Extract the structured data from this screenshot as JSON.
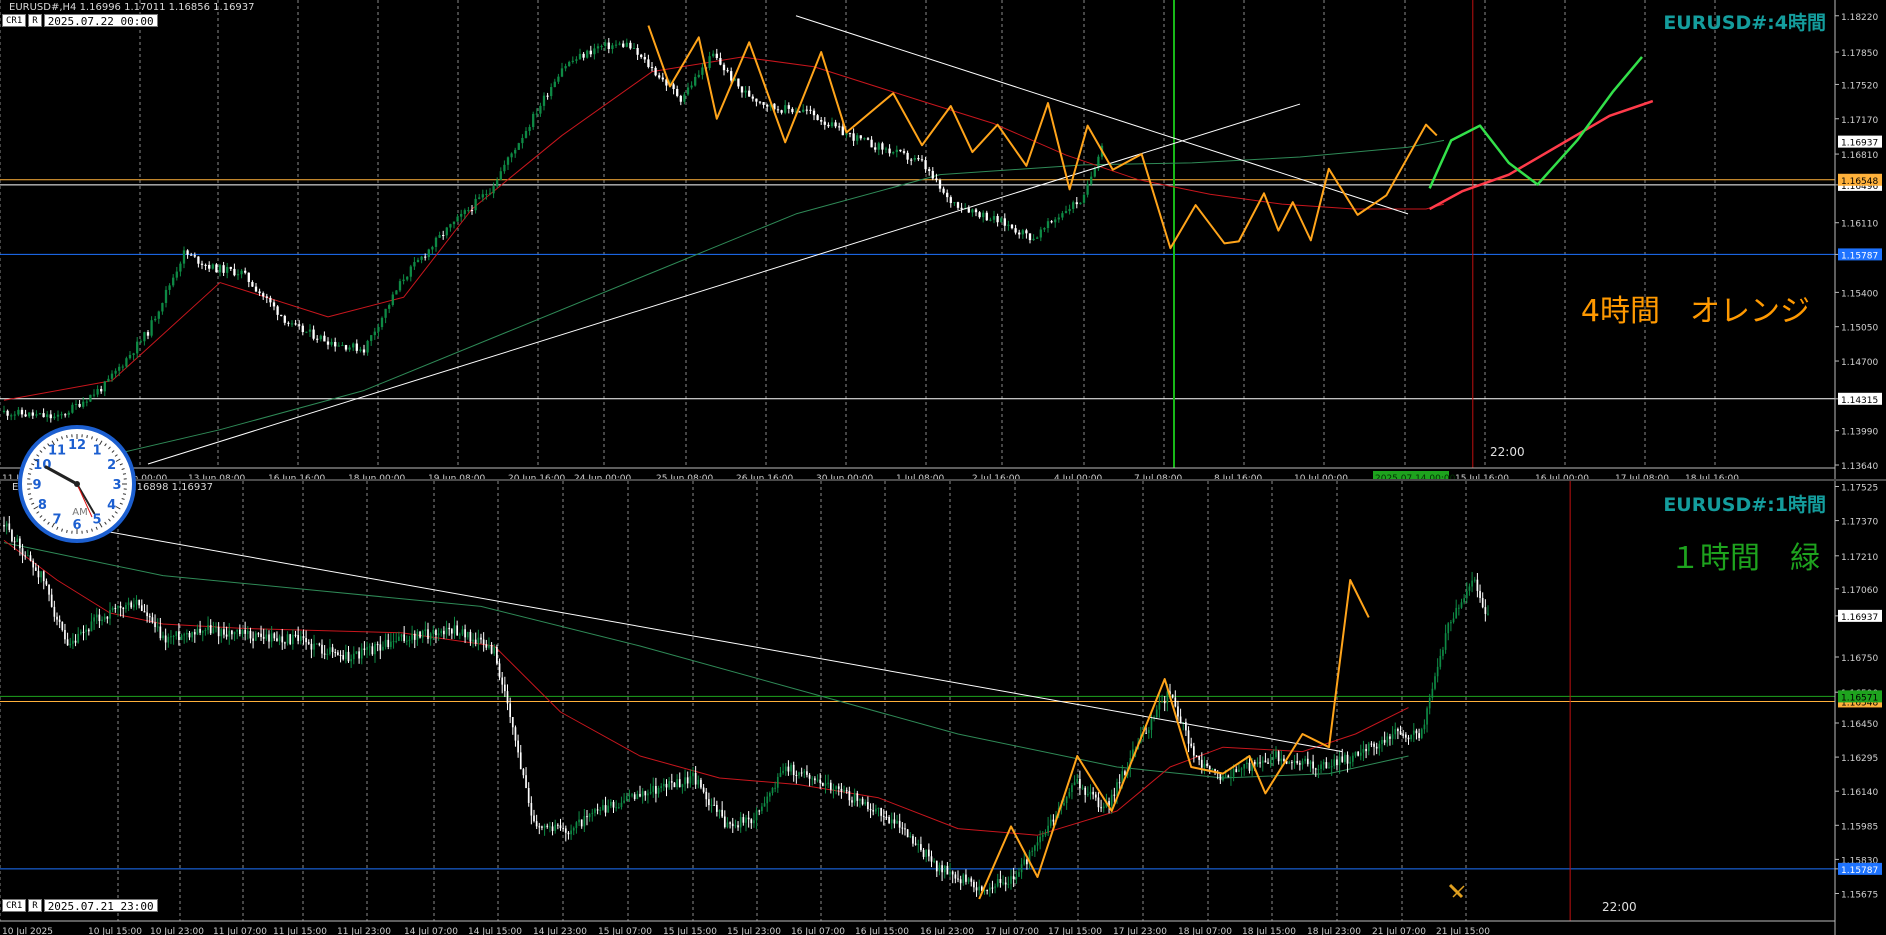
{
  "colors": {
    "background": "#000000",
    "bull_candle": "#0e8a45",
    "bear_candle": "#ffffff",
    "zigzag": "#ffa41a",
    "ma_red": "#c8161d",
    "ma_green": "#2f8a57",
    "trend_line": "#ffffff",
    "level_orange": "#ffb13b",
    "level_blue": "#1e73ff",
    "proj_green": "#33e04a",
    "proj_red": "#ff3b4a",
    "title_teal": "#149d9d",
    "note_orange": "#ff9900",
    "note_green": "#1ea31e",
    "vline_green": "#18b818",
    "vline_red": "#c01010"
  },
  "top": {
    "info": "EURUSD#,H4  1.16996 1.17011 1.16856 1.16937",
    "crosshair_chip": "2025.07.22 00:00",
    "chip_a": "CR1",
    "chip_b": "R",
    "title": "EURUSD#:4時間",
    "note": "4時間　オレンジ",
    "time_label": "22:00",
    "highlight_time": "2025.07.14 00:00"
  },
  "bottom": {
    "info": "EURUSD#,H1  1.16956 1.16898 1.16937",
    "crosshair_chip": "2025.07.21 23:00",
    "chip_a": "CR1",
    "chip_b": "R",
    "title": "EURUSD#:1時間",
    "note": "１時間　緑",
    "time_label": "22:00"
  },
  "clock": {
    "label": "AM",
    "numerals": [
      "12",
      "1",
      "2",
      "3",
      "4",
      "5",
      "6",
      "7",
      "8",
      "9",
      "10",
      "11"
    ]
  },
  "chart_data": [
    {
      "type": "candlestick",
      "title": "EURUSD#:4時間",
      "timeframe": "H4",
      "ylim": [
        1.1364,
        1.1834
      ],
      "y_ticks": [
        "1.18220",
        "1.17850",
        "1.17520",
        "1.17170",
        "1.16810",
        "1.16496",
        "1.16110",
        "1.15787",
        "1.15400",
        "1.15050",
        "1.14700",
        "1.14315",
        "1.13990",
        "1.13640"
      ],
      "x_ticks": [
        "11 Jun 2025",
        "12 Jun 00:00",
        "13 Jun 08:00",
        "16 Jun 16:00",
        "18 Jun 00:00",
        "19 Jun 08:00",
        "20 Jun 16:00",
        "24 Jun 00:00",
        "25 Jun 08:00",
        "26 Jun 16:00",
        "30 Jun 00:00",
        "1 Jul 08:00",
        "2 Jul 16:00",
        "4 Jul 00:00",
        "7 Jul 08:00",
        "8 Jul 16:00",
        "10 Jul 00:00",
        "2025.07.14 00:00",
        "15 Jul 16:00",
        "16 Jul 00:00",
        "17 Jul 08:00",
        "18 Jul 16:00"
      ],
      "y_labels_highlight": [
        {
          "value": "1.16937",
          "bg": "#ffffff",
          "fg": "#000000"
        },
        {
          "value": "1.16496",
          "bg": "#ffffff",
          "fg": "#000000"
        },
        {
          "value": "1.16548",
          "bg": "#ffb13b",
          "fg": "#000000"
        },
        {
          "value": "1.15787",
          "bg": "#1e73ff",
          "fg": "#ffffff"
        },
        {
          "value": "1.14315",
          "bg": "#ffffff",
          "fg": "#000000"
        }
      ],
      "close_path": [
        [
          0,
          1.1418
        ],
        [
          15,
          1.1412
        ],
        [
          28,
          1.1445
        ],
        [
          40,
          1.15
        ],
        [
          50,
          1.158
        ],
        [
          58,
          1.1565
        ],
        [
          66,
          1.156
        ],
        [
          80,
          1.1505
        ],
        [
          92,
          1.1488
        ],
        [
          100,
          1.1482
        ],
        [
          111,
          1.1555
        ],
        [
          122,
          1.16
        ],
        [
          135,
          1.1645
        ],
        [
          146,
          1.1712
        ],
        [
          155,
          1.177
        ],
        [
          165,
          1.179
        ],
        [
          173,
          1.1793
        ],
        [
          180,
          1.1768
        ],
        [
          188,
          1.1738
        ],
        [
          197,
          1.1782
        ],
        [
          205,
          1.1745
        ],
        [
          214,
          1.1728
        ],
        [
          223,
          1.1725
        ],
        [
          232,
          1.1705
        ],
        [
          240,
          1.1692
        ],
        [
          247,
          1.1683
        ],
        [
          255,
          1.1672
        ],
        [
          262,
          1.1635
        ],
        [
          270,
          1.1622
        ],
        [
          278,
          1.161
        ],
        [
          286,
          1.1595
        ],
        [
          295,
          1.1625
        ],
        [
          300,
          1.1636
        ],
        [
          305,
          1.1693
        ]
      ],
      "zigzag": [
        [
          179,
          1.1812
        ],
        [
          185,
          1.175
        ],
        [
          193,
          1.18
        ],
        [
          198,
          1.1717
        ],
        [
          207,
          1.1795
        ],
        [
          217,
          1.1693
        ],
        [
          227,
          1.1785
        ],
        [
          234,
          1.1703
        ],
        [
          247,
          1.1743
        ],
        [
          255,
          1.169
        ],
        [
          263,
          1.173
        ],
        [
          269,
          1.1683
        ],
        [
          276,
          1.1711
        ],
        [
          284,
          1.1669
        ],
        [
          290,
          1.1733
        ],
        [
          296,
          1.1645
        ],
        [
          301,
          1.171
        ],
        [
          308,
          1.1665
        ],
        [
          316,
          1.1681
        ],
        [
          324,
          1.1585
        ],
        [
          331,
          1.1629
        ],
        [
          339,
          1.159
        ],
        [
          343,
          1.1592
        ],
        [
          350,
          1.1641
        ],
        [
          354,
          1.1603
        ],
        [
          358,
          1.1632
        ],
        [
          363,
          1.1593
        ],
        [
          368,
          1.1666
        ],
        [
          376,
          1.1619
        ],
        [
          384,
          1.1639
        ],
        [
          395,
          1.1711
        ],
        [
          398,
          1.17
        ]
      ],
      "ma_red": [
        [
          0,
          1.143
        ],
        [
          30,
          1.145
        ],
        [
          60,
          1.155
        ],
        [
          90,
          1.1515
        ],
        [
          111,
          1.1535
        ],
        [
          130,
          1.1625
        ],
        [
          155,
          1.17
        ],
        [
          180,
          1.1765
        ],
        [
          205,
          1.178
        ],
        [
          225,
          1.177
        ],
        [
          255,
          1.1735
        ],
        [
          275,
          1.1712
        ],
        [
          295,
          1.168
        ],
        [
          315,
          1.1655
        ],
        [
          335,
          1.164
        ],
        [
          355,
          1.163
        ],
        [
          375,
          1.1625
        ],
        [
          395,
          1.1625
        ],
        [
          400,
          1.163
        ]
      ],
      "ma_green": [
        [
          25,
          1.137
        ],
        [
          60,
          1.14
        ],
        [
          100,
          1.144
        ],
        [
          140,
          1.15
        ],
        [
          180,
          1.156
        ],
        [
          220,
          1.162
        ],
        [
          260,
          1.166
        ],
        [
          300,
          1.167
        ],
        [
          330,
          1.1672
        ],
        [
          360,
          1.1678
        ],
        [
          390,
          1.1688
        ],
        [
          400,
          1.1695
        ]
      ],
      "trendlines": [
        [
          [
            40,
            1.1365
          ],
          [
            360,
            1.1732
          ]
        ],
        [
          [
            220,
            1.1822
          ],
          [
            390,
            1.162
          ]
        ]
      ],
      "levels": [
        {
          "value": 1.14315,
          "color": "white"
        },
        {
          "value": 1.16496,
          "color": "white"
        },
        {
          "value": 1.16548,
          "color": "orange"
        },
        {
          "value": 1.15787,
          "color": "blue"
        }
      ],
      "projection_green": [
        [
          396,
          1.1646
        ],
        [
          402,
          1.1695
        ],
        [
          410,
          1.171
        ],
        [
          418,
          1.1672
        ],
        [
          426,
          1.165
        ],
        [
          437,
          1.1695
        ],
        [
          447,
          1.1745
        ],
        [
          455,
          1.178
        ]
      ],
      "projection_red": [
        [
          396,
          1.1625
        ],
        [
          405,
          1.1643
        ],
        [
          418,
          1.166
        ],
        [
          432,
          1.169
        ],
        [
          446,
          1.172
        ],
        [
          458,
          1.1735
        ]
      ],
      "vertical_lines": [
        {
          "bar": 325,
          "color": "green"
        },
        {
          "bar": 408,
          "color": "red"
        }
      ]
    },
    {
      "type": "candlestick",
      "title": "EURUSD#:1時間",
      "timeframe": "H1",
      "ylim": [
        1.1555,
        1.1755
      ],
      "y_ticks": [
        "1.17525",
        "1.17370",
        "1.17210",
        "1.17060",
        "1.16937",
        "1.16750",
        "1.16590",
        "1.16450",
        "1.16295",
        "1.16140",
        "1.15985",
        "1.15830",
        "1.15787",
        "1.15675"
      ],
      "x_ticks": [
        "10 Jul 2025",
        "10 Jul 15:00",
        "10 Jul 23:00",
        "11 Jul 07:00",
        "11 Jul 15:00",
        "11 Jul 23:00",
        "14 Jul 07:00",
        "14 Jul 15:00",
        "14 Jul 23:00",
        "15 Jul 07:00",
        "15 Jul 15:00",
        "15 Jul 23:00",
        "16 Jul 07:00",
        "16 Jul 15:00",
        "16 Jul 23:00",
        "17 Jul 07:00",
        "17 Jul 15:00",
        "17 Jul 23:00",
        "18 Jul 07:00",
        "18 Jul 15:00",
        "18 Jul 23:00",
        "21 Jul 07:00",
        "21 Jul 15:00"
      ],
      "y_labels_highlight": [
        {
          "value": "1.16937",
          "bg": "#ffffff",
          "fg": "#000000"
        },
        {
          "value": "1.16548",
          "bg": "#ffb13b",
          "fg": "#000000"
        },
        {
          "value": "1.16571",
          "bg": "#1ea31e",
          "fg": "#000000"
        },
        {
          "value": "1.15787",
          "bg": "#1e73ff",
          "fg": "#ffffff"
        }
      ],
      "close_path": [
        [
          0,
          1.1735
        ],
        [
          15,
          1.171
        ],
        [
          24,
          1.1678
        ],
        [
          35,
          1.1692
        ],
        [
          50,
          1.17
        ],
        [
          60,
          1.1683
        ],
        [
          75,
          1.1688
        ],
        [
          90,
          1.1685
        ],
        [
          110,
          1.1683
        ],
        [
          130,
          1.1675
        ],
        [
          150,
          1.1683
        ],
        [
          170,
          1.1688
        ],
        [
          185,
          1.1678
        ],
        [
          200,
          1.16
        ],
        [
          212,
          1.1596
        ],
        [
          225,
          1.1605
        ],
        [
          245,
          1.1615
        ],
        [
          260,
          1.162
        ],
        [
          272,
          1.16
        ],
        [
          282,
          1.16
        ],
        [
          295,
          1.1625
        ],
        [
          310,
          1.1618
        ],
        [
          322,
          1.161
        ],
        [
          336,
          1.16
        ],
        [
          352,
          1.158
        ],
        [
          368,
          1.157
        ],
        [
          382,
          1.1575
        ],
        [
          395,
          1.16
        ],
        [
          405,
          1.1618
        ],
        [
          415,
          1.1605
        ],
        [
          430,
          1.164
        ],
        [
          440,
          1.166
        ],
        [
          450,
          1.1628
        ],
        [
          460,
          1.162
        ],
        [
          480,
          1.163
        ],
        [
          495,
          1.1625
        ],
        [
          510,
          1.163
        ],
        [
          525,
          1.164
        ],
        [
          535,
          1.164
        ],
        [
          545,
          1.169
        ],
        [
          555,
          1.171
        ],
        [
          560,
          1.1693
        ]
      ],
      "zigzag": [
        [
          368,
          1.1565
        ],
        [
          380,
          1.1598
        ],
        [
          390,
          1.1575
        ],
        [
          405,
          1.163
        ],
        [
          418,
          1.1605
        ],
        [
          438,
          1.1665
        ],
        [
          448,
          1.1625
        ],
        [
          460,
          1.1622
        ],
        [
          470,
          1.163
        ],
        [
          476,
          1.1613
        ],
        [
          490,
          1.164
        ],
        [
          500,
          1.1634
        ],
        [
          508,
          1.171
        ],
        [
          515,
          1.1693
        ]
      ],
      "ma_red": [
        [
          0,
          1.1728
        ],
        [
          20,
          1.171
        ],
        [
          40,
          1.1695
        ],
        [
          60,
          1.169
        ],
        [
          90,
          1.1688
        ],
        [
          120,
          1.1687
        ],
        [
          150,
          1.1686
        ],
        [
          185,
          1.168
        ],
        [
          210,
          1.165
        ],
        [
          240,
          1.163
        ],
        [
          270,
          1.162
        ],
        [
          300,
          1.1617
        ],
        [
          330,
          1.1611
        ],
        [
          360,
          1.1597
        ],
        [
          390,
          1.1594
        ],
        [
          420,
          1.1605
        ],
        [
          440,
          1.1625
        ],
        [
          460,
          1.1634
        ],
        [
          490,
          1.1632
        ],
        [
          510,
          1.164
        ],
        [
          530,
          1.1652
        ]
      ],
      "ma_green": [
        [
          0,
          1.1727
        ],
        [
          60,
          1.1712
        ],
        [
          120,
          1.1705
        ],
        [
          180,
          1.1698
        ],
        [
          240,
          1.168
        ],
        [
          300,
          1.166
        ],
        [
          360,
          1.164
        ],
        [
          420,
          1.1625
        ],
        [
          460,
          1.162
        ],
        [
          500,
          1.1622
        ],
        [
          530,
          1.163
        ]
      ],
      "trendlines": [
        [
          [
            25,
            1.1735
          ],
          [
            505,
            1.1632
          ]
        ]
      ],
      "levels": [
        {
          "value": 1.16548,
          "color": "orange"
        },
        {
          "value": 1.16571,
          "color": "green"
        },
        {
          "value": 1.15787,
          "color": "blue"
        }
      ],
      "vertical_lines": [
        {
          "bar": 591,
          "color": "red"
        }
      ]
    }
  ]
}
